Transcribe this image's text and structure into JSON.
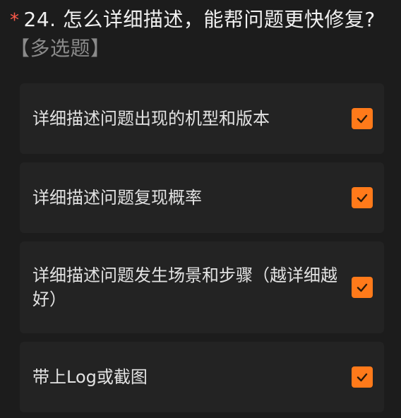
{
  "question": {
    "required_mark": "*",
    "number_title": "24. 怎么详细描述，能帮问题更快修复?",
    "type_label": "【多选题】"
  },
  "options": [
    {
      "label": "详细描述问题出现的机型和版本",
      "checked": true
    },
    {
      "label": "详细描述问题复现概率",
      "checked": true
    },
    {
      "label": "详细描述问题发生场景和步骤（越详细越好）",
      "checked": true
    },
    {
      "label": "带上Log或截图",
      "checked": true
    }
  ],
  "colors": {
    "background": "#1c1c1c",
    "card": "#232323",
    "accent": "#ff7a1a",
    "required": "#ff5a4a"
  },
  "icons": {
    "checkbox": "checkmark-icon"
  }
}
